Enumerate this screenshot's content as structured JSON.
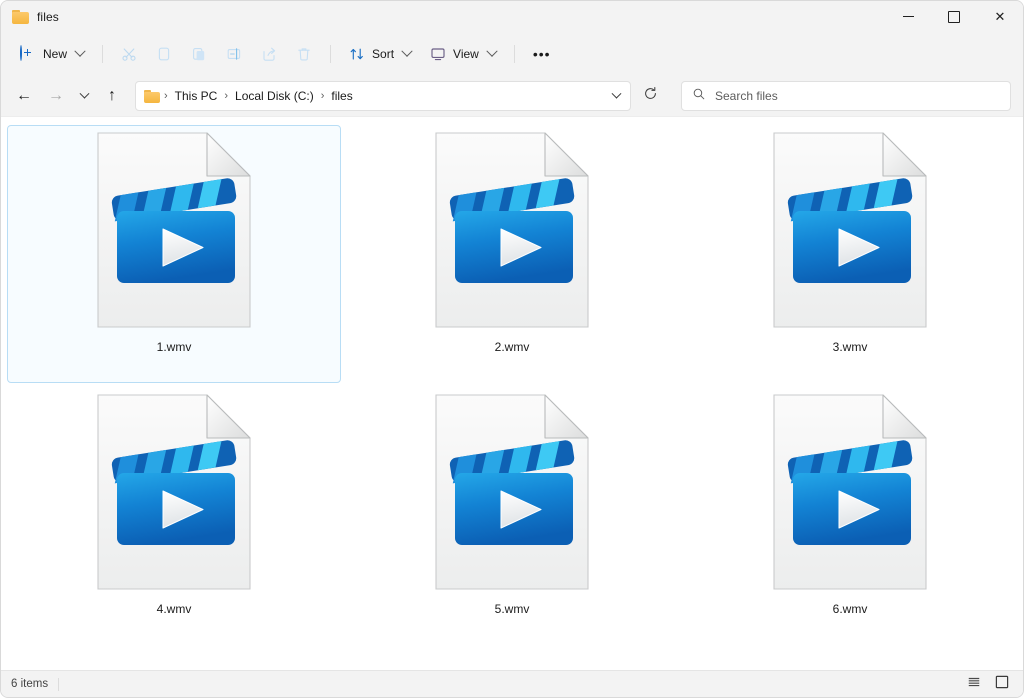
{
  "window": {
    "title": "files",
    "title_icon": "folder-icon",
    "controls": {
      "minimize": "─",
      "maximize": "□",
      "close": "✕"
    }
  },
  "toolbar": {
    "new_label": "New",
    "new_icon": "plus-circle-icon",
    "cut_icon": "scissors-icon",
    "copy_icon": "copy-icon",
    "paste_icon": "paste-icon",
    "rename_icon": "rename-icon",
    "share_icon": "share-icon",
    "delete_icon": "trash-icon",
    "sort_label": "Sort",
    "sort_icon": "sort-arrows-icon",
    "view_label": "View",
    "view_icon": "monitor-icon",
    "more_label": "•••"
  },
  "addressbar": {
    "back_icon": "arrow-left-icon",
    "forward_icon": "arrow-right-icon",
    "history_icon": "chevron-down-icon",
    "up_icon": "arrow-up-icon",
    "folder_icon": "folder-icon",
    "separator": "›",
    "crumbs": [
      {
        "label": "This PC"
      },
      {
        "label": "Local Disk (C:)"
      },
      {
        "label": "files"
      }
    ],
    "dropdown_icon": "chevron-down-icon",
    "refresh_icon": "refresh-icon"
  },
  "search": {
    "icon": "search-icon",
    "placeholder": "Search files",
    "value": ""
  },
  "files": [
    {
      "name": "1.wmv",
      "type": "wmv",
      "selected": true
    },
    {
      "name": "2.wmv",
      "type": "wmv",
      "selected": false
    },
    {
      "name": "3.wmv",
      "type": "wmv",
      "selected": false
    },
    {
      "name": "4.wmv",
      "type": "wmv",
      "selected": false
    },
    {
      "name": "5.wmv",
      "type": "wmv",
      "selected": false
    },
    {
      "name": "6.wmv",
      "type": "wmv",
      "selected": false
    }
  ],
  "statusbar": {
    "items_count": "6 items",
    "details_view_icon": "list-view-icon",
    "large_icons_view_icon": "large-icons-view-icon"
  },
  "colors": {
    "accent": "#1668c5",
    "selection_border": "#b8ddf5",
    "selection_fill": "#f7fcff",
    "window_chrome": "#f3f3f3",
    "clapper_dark": "#0f62b4",
    "clapper_light": "#37c3f2",
    "body_top": "#1d9fe3",
    "body_bottom": "#0c63b8"
  }
}
